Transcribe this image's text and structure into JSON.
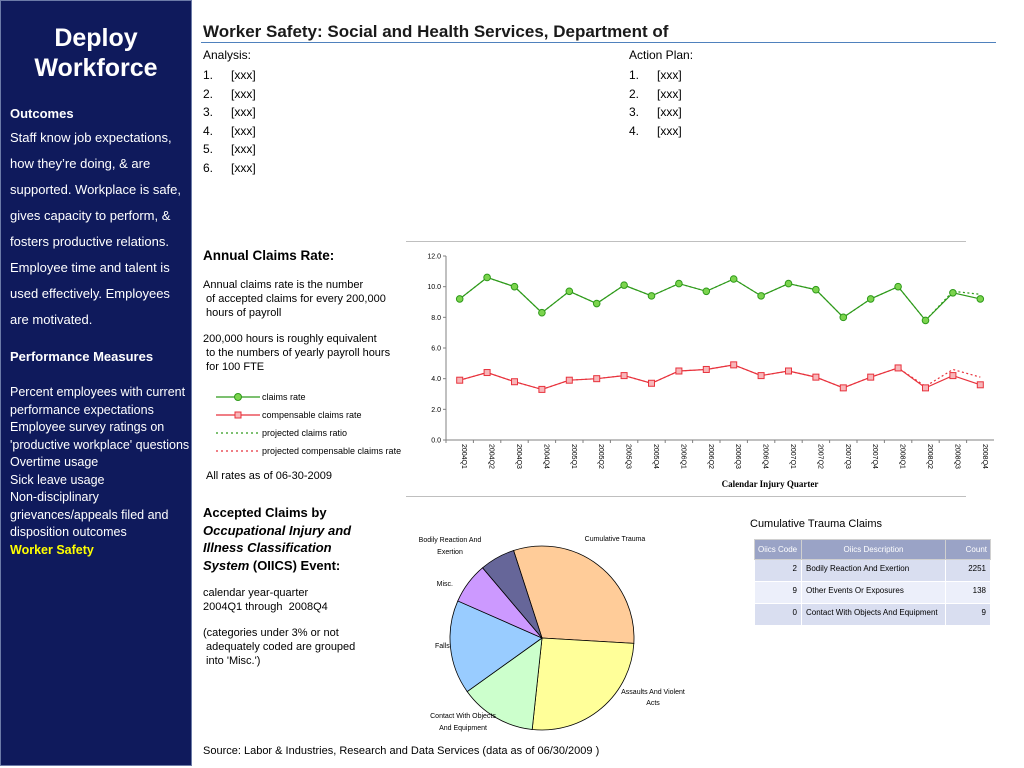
{
  "sidebar": {
    "title_line1": "Deploy",
    "title_line2": "Workforce",
    "outcomes_heading": "Outcomes",
    "outcomes_lines": [
      "Staff know job expectations,",
      "how they’re doing, & are",
      "supported. Workplace is safe,",
      "gives capacity to perform, &",
      "fosters productive relations.",
      "Employee time and talent is",
      "used effectively. Employees",
      "are motivated."
    ],
    "measures_heading": "Performance Measures",
    "measures": [
      "Percent employees with current performance expectations",
      "Employee survey ratings on 'productive workplace' questions",
      "Overtime usage",
      "Sick leave usage",
      "Non-disciplinary grievances/appeals filed and disposition outcomes",
      "Worker Safety"
    ],
    "active_measure": "Worker Safety",
    "colors": {
      "background": "#0f1a5c",
      "active": "#ffff00"
    }
  },
  "page_title": "Worker Safety: Social and Health Services, Department of",
  "analysis": {
    "heading": "Analysis:",
    "items": [
      {
        "n": "1.",
        "text": "[xxx]"
      },
      {
        "n": "2.",
        "text": "[xxx]"
      },
      {
        "n": "3.",
        "text": "[xxx]"
      },
      {
        "n": "4.",
        "text": "[xxx]"
      },
      {
        "n": "5.",
        "text": "[xxx]"
      },
      {
        "n": "6.",
        "text": "[xxx]"
      }
    ]
  },
  "action_plan": {
    "heading": "Action Plan:",
    "items": [
      {
        "n": "1.",
        "text": "[xxx]"
      },
      {
        "n": "2.",
        "text": "[xxx]"
      },
      {
        "n": "3.",
        "text": "[xxx]"
      },
      {
        "n": "4.",
        "text": "[xxx]"
      }
    ]
  },
  "claims_section": {
    "heading": "Annual Claims Rate:",
    "para1": "Annual claims rate is the number\n of accepted claims for every 200,000\n hours of payroll",
    "para2": "200,000 hours is roughly equivalent\n to the numbers of yearly payroll hours\n for 100 FTE",
    "note": "All rates as of 06-30-2009"
  },
  "occ_section": {
    "heading_line1": "Accepted Claims by",
    "heading_line2": "Occupational Injury and",
    "heading_line3": "Illness Classification",
    "heading_line4_italic": "System",
    "heading_line4_rest": " (OIICS) Event:",
    "para1": "calendar year-quarter\n2004Q1 through  2008Q4",
    "para2": "(categories under 3% or not\n adequately coded are grouped\n into 'Misc.')"
  },
  "chart_data": [
    {
      "type": "line",
      "xlabel": "Calendar Injury Quarter",
      "ylabel": "",
      "ylim": [
        0,
        12
      ],
      "yticks": [
        "0.0",
        "2.0",
        "4.0",
        "6.0",
        "8.0",
        "10.0",
        "12.0"
      ],
      "x": [
        "2004Q1",
        "2004Q2",
        "2004Q3",
        "2004Q4",
        "2005Q1",
        "2005Q2",
        "2005Q3",
        "2005Q4",
        "2006Q1",
        "2006Q2",
        "2006Q3",
        "2006Q4",
        "2007Q1",
        "2007Q2",
        "2007Q3",
        "2007Q4",
        "2008Q1",
        "2008Q2",
        "2008Q3",
        "2008Q4"
      ],
      "legend_position": "left",
      "series": [
        {
          "name": "claims rate",
          "color": "#2e9a1a",
          "style": "solid-circle",
          "values": [
            9.2,
            10.6,
            10.0,
            8.3,
            9.7,
            8.9,
            10.1,
            9.4,
            10.2,
            9.7,
            10.5,
            9.4,
            10.2,
            9.8,
            8.0,
            9.2,
            10.0,
            7.8,
            9.6,
            9.2
          ]
        },
        {
          "name": "compensable claims rate",
          "color": "#e8323c",
          "style": "solid-square",
          "values": [
            3.9,
            4.4,
            3.8,
            3.3,
            3.9,
            4.0,
            4.2,
            3.7,
            4.5,
            4.6,
            4.9,
            4.2,
            4.5,
            4.1,
            3.4,
            4.1,
            4.7,
            3.4,
            4.2,
            3.6
          ]
        },
        {
          "name": "projected claims ratio",
          "color": "#2e9a1a",
          "style": "dotted",
          "values": [
            9.2,
            10.6,
            10.0,
            8.3,
            9.7,
            8.9,
            10.1,
            9.4,
            10.2,
            9.7,
            10.5,
            9.4,
            10.2,
            9.8,
            8.0,
            9.2,
            10.0,
            7.8,
            9.7,
            9.5
          ]
        },
        {
          "name": "projected compensable claims rate",
          "color": "#e8323c",
          "style": "dotted",
          "values": [
            3.9,
            4.4,
            3.8,
            3.3,
            3.9,
            4.0,
            4.2,
            3.7,
            4.5,
            4.6,
            4.9,
            4.2,
            4.5,
            4.1,
            3.4,
            4.1,
            4.7,
            3.5,
            4.6,
            4.1
          ]
        }
      ]
    },
    {
      "type": "pie",
      "slices": [
        {
          "label": "Cumulative Trauma",
          "value": 30,
          "color": "#ffcc99"
        },
        {
          "label": "Assaults And Violent Acts",
          "value": 25,
          "color": "#ffff99"
        },
        {
          "label": "Contact With Objects And Equipment",
          "value": 13,
          "color": "#ccffcc"
        },
        {
          "label": "Falls",
          "value": 16,
          "color": "#99ccff"
        },
        {
          "label": "Misc.",
          "value": 7,
          "color": "#cc99ff"
        },
        {
          "label": "Bodily Reaction And Exertion",
          "value": 6,
          "color": "#666699"
        }
      ]
    }
  ],
  "pie_labels": {
    "cumulative": "Cumulative Trauma",
    "assaults_1": "Assaults And Violent",
    "assaults_2": "Acts",
    "contact_1": "Contact With Objects",
    "contact_2": "And Equipment",
    "falls": "Falls",
    "misc": "Misc.",
    "bodily_1": "Bodily Reaction And",
    "bodily_2": "Exertion"
  },
  "trauma_table": {
    "title": "Cumulative Trauma Claims",
    "headers": [
      "Oiics Code",
      "Oiics Description",
      "Count"
    ],
    "rows": [
      {
        "code": "2",
        "desc": "Bodily Reaction And Exertion",
        "count": "2251"
      },
      {
        "code": "9",
        "desc": "Other Events Or Exposures",
        "count": "138"
      },
      {
        "code": "0",
        "desc": "Contact With Objects And Equipment",
        "count": "9"
      }
    ]
  },
  "source": "Source: Labor & Industries, Research and Data Services (data as of 06/30/2009 )"
}
